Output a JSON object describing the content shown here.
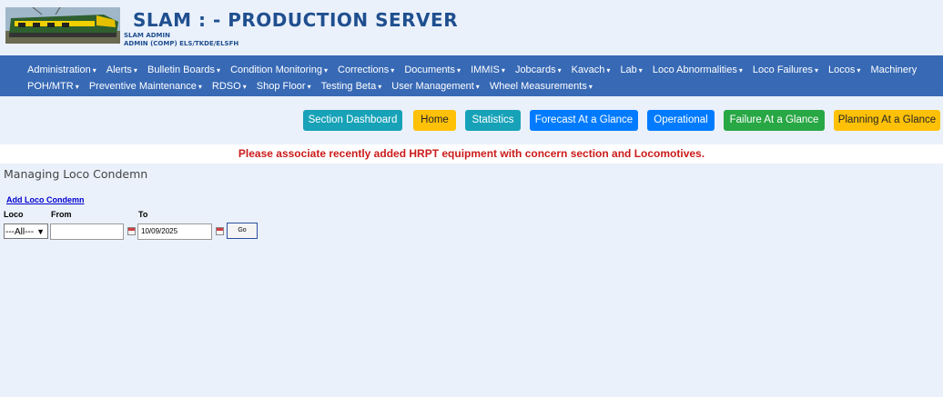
{
  "header": {
    "title": "SLAM : - PRODUCTION SERVER",
    "user_name": "SLAM ADMIN",
    "user_role": "ADMIN (COMP) ELS/TKDE/ELSFH",
    "logo_icon": "locomotive-logo-icon"
  },
  "nav": {
    "row1": [
      "Administration",
      "Alerts",
      "Bulletin Boards",
      "Condition Monitoring",
      "Corrections",
      "Documents",
      "IMMIS",
      "Jobcards",
      "Kavach",
      "Lab",
      "Loco Abnormalities",
      "Loco Failures",
      "Locos",
      "Machinery"
    ],
    "row2": [
      "POH/MTR",
      "Preventive Maintenance",
      "RDSO",
      "Shop Floor",
      "Testing Beta",
      "User Management",
      "Wheel Measurements"
    ]
  },
  "buttons": {
    "section_dashboard": "Section Dashboard",
    "home": "Home",
    "statistics": "Statistics",
    "forecast": "Forecast At a Glance",
    "operational": "Operational",
    "failure": "Failure At a Glance",
    "planning": "Planning At a Glance"
  },
  "colors": {
    "teal": "#17a2b8",
    "yellow": "#ffc107",
    "blue": "#007bff",
    "green": "#28a745",
    "nav_bg": "#3769b5",
    "alert": "#cc1a1a"
  },
  "alert": "Please associate recently added HRPT equipment with concern section and Locomotives.",
  "page": {
    "title": "Managing Loco Condemn",
    "add_link": "Add Loco Condemn"
  },
  "filters": {
    "loco_label": "Loco",
    "from_label": "From",
    "to_label": "To",
    "loco_value": "---All---",
    "from_value": "",
    "to_value": "10/09/2025",
    "go_label": "Go"
  }
}
